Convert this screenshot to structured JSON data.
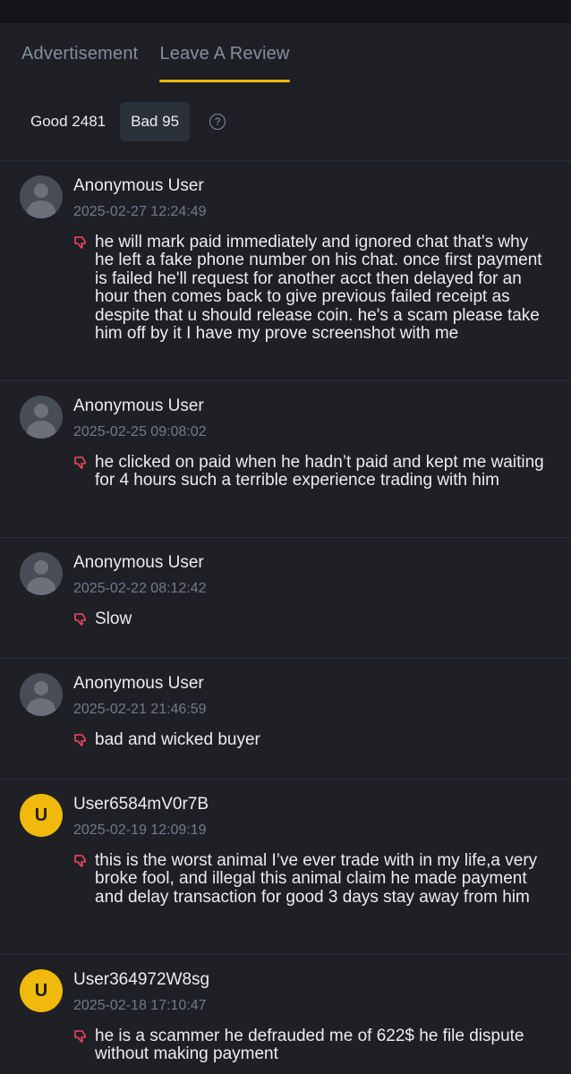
{
  "tabs": [
    {
      "label": "Advertisement"
    },
    {
      "label": "Leave A Review"
    }
  ],
  "filters": {
    "good_label": "Good 2481",
    "bad_label": "Bad 95",
    "help_icon": "question-circle-icon"
  },
  "reviews": [
    {
      "name": "Anonymous User",
      "date": "2025-02-27 12:24:49",
      "text": "he will mark paid immediately and ignored chat that's why he left a fake phone number on his chat. once first payment is failed he'll request for another acct then delayed for an hour then comes back to give previous failed receipt as despite that u should release coin. he's a scam please take him off by it I have my prove screenshot with me"
    },
    {
      "name": "Anonymous User",
      "date": "2025-02-25 09:08:02",
      "text": "he clicked on paid when he hadn’t paid and kept me waiting for 4 hours such a terrible experience trading with him"
    },
    {
      "name": "Anonymous User",
      "date": "2025-02-22 08:12:42",
      "text": "Slow"
    },
    {
      "name": "Anonymous User",
      "date": "2025-02-21 21:46:59",
      "text": "bad and wicked buyer"
    },
    {
      "name": "User6584mV0r7B",
      "avatar_letter": "U",
      "date": "2025-02-19 12:09:19",
      "text": "this is the worst animal I’ve ever trade with in my life,a very broke fool, and illegal this animal claim he made payment and delay transaction for good 3 days stay away from him"
    },
    {
      "name": "User364972W8sg",
      "avatar_letter": "U",
      "date": "2025-02-18 17:10:47",
      "text": "he is a scammer he defrauded me of 622$ he file dispute without making payment"
    }
  ],
  "colors": {
    "accent": "#f0b90b",
    "negative": "#f6465d",
    "background": "#1e2026"
  }
}
